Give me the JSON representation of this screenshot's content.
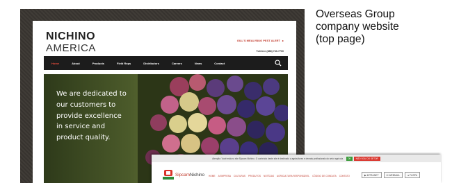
{
  "caption": {
    "lines": [
      "Overseas Group",
      "company website",
      "(top page)"
    ]
  },
  "main_site": {
    "logo": {
      "top": "NICHINO",
      "bottom": "AMERICA"
    },
    "alert_link": "GILL'S MEALYBUG PEST ALERT",
    "toll_free": "Toll-free (888) 740-7700",
    "nav": [
      "Home",
      "About",
      "Products",
      "Field Reps",
      "Distributors",
      "Careers",
      "News",
      "Contact"
    ],
    "hero_lines": [
      "We are dedicated to",
      "our customers to",
      "provide excellence",
      "in service and",
      "product quality."
    ]
  },
  "sub_site": {
    "notice": "Atenção: Você está no site Sipcam Nichino. O conteúdo deste site é destinado a agricultores e demais profissionais do setor agrícola.",
    "ok_label": "OK",
    "decline_label": "NÃO SOU DO SETOR",
    "logo_prefix": "Sipcam",
    "logo_suffix": "Nichino",
    "nav": [
      "HOME",
      "A EMPRESA",
      "CULTURAS",
      "PRODUTOS",
      "NOTÍCIAS",
      "AGRICULTURA RESPONSÁVEL",
      "CÓDIGO DE CONDUTA",
      "CONTATO"
    ],
    "buttons": [
      "INTRANET",
      "WEBMAIL",
      "FUSPA"
    ]
  }
}
